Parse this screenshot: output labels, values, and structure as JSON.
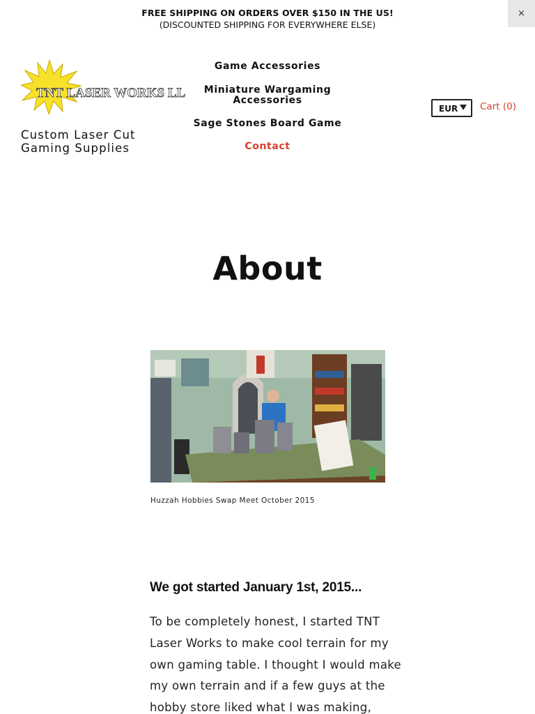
{
  "announcement": {
    "line1": "FREE SHIPPING ON ORDERS OVER $150 IN THE US!",
    "line2": "(DISCOUNTED SHIPPING FOR EVERYWHERE ELSE)",
    "close_label": "×"
  },
  "header": {
    "logo_text": "TNT LASER WORKS LLC",
    "tagline_line1": "Custom Laser Cut",
    "tagline_line2": "Gaming Supplies",
    "nav": [
      {
        "label": "Game Accessories"
      },
      {
        "label_line1": "Miniature Wargaming",
        "label_line2": "Accessories"
      },
      {
        "label": "Sage Stones Board Game"
      },
      {
        "label": "Contact",
        "active": true
      }
    ],
    "currency": "EUR",
    "cart_label": "Cart",
    "cart_count": "(0)"
  },
  "page": {
    "title": "About",
    "image_caption": "Huzzah Hobbies Swap Meet October 2015",
    "subheading": "We got started January 1st, 2015...",
    "body_lines": [
      "To be completely honest, I started TNT",
      "Laser Works to make cool terrain for my",
      "own gaming table. I thought I would make",
      "my own terrain and if a few guys at the",
      "hobby store liked what I was making,"
    ]
  },
  "colors": {
    "accent": "#d9412f",
    "text": "#111111",
    "logo_star": "#f7e12b"
  }
}
